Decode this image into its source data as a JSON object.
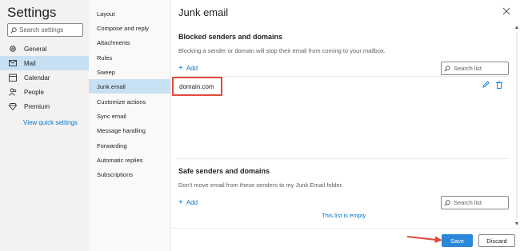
{
  "settings": {
    "title": "Settings",
    "search_placeholder": "Search settings",
    "nav": [
      {
        "label": "General",
        "icon": "gear-icon"
      },
      {
        "label": "Mail",
        "icon": "mail-icon",
        "selected": true
      },
      {
        "label": "Calendar",
        "icon": "calendar-icon"
      },
      {
        "label": "People",
        "icon": "people-icon"
      },
      {
        "label": "Premium",
        "icon": "diamond-icon"
      }
    ],
    "quick_settings": "View quick settings"
  },
  "mail_submenu": [
    {
      "label": "Layout"
    },
    {
      "label": "Compose and reply"
    },
    {
      "label": "Attachments"
    },
    {
      "label": "Rules"
    },
    {
      "label": "Sweep"
    },
    {
      "label": "Junk email",
      "selected": true
    },
    {
      "label": "Customize actions"
    },
    {
      "label": "Sync email"
    },
    {
      "label": "Message handling"
    },
    {
      "label": "Forwarding"
    },
    {
      "label": "Automatic replies"
    },
    {
      "label": "Subscriptions"
    }
  ],
  "junk": {
    "title": "Junk email",
    "blocked": {
      "title": "Blocked senders and domains",
      "description": "Blocking a sender or domain will stop their email from coming to your mailbox.",
      "add_label": "Add",
      "search_placeholder": "Search list",
      "entries": [
        "domain.com"
      ]
    },
    "safe": {
      "title": "Safe senders and domains",
      "description": "Don't move email from these senders to my Junk Email folder.",
      "add_label": "Add",
      "search_placeholder": "Search list",
      "empty_text": "This list is empty"
    },
    "save_label": "Save",
    "discard_label": "Discard"
  },
  "colors": {
    "accent": "#0078d4",
    "selected_bg": "#c7e0f4",
    "highlight_border": "#e04a3a",
    "save_bg": "#2b88d8"
  }
}
